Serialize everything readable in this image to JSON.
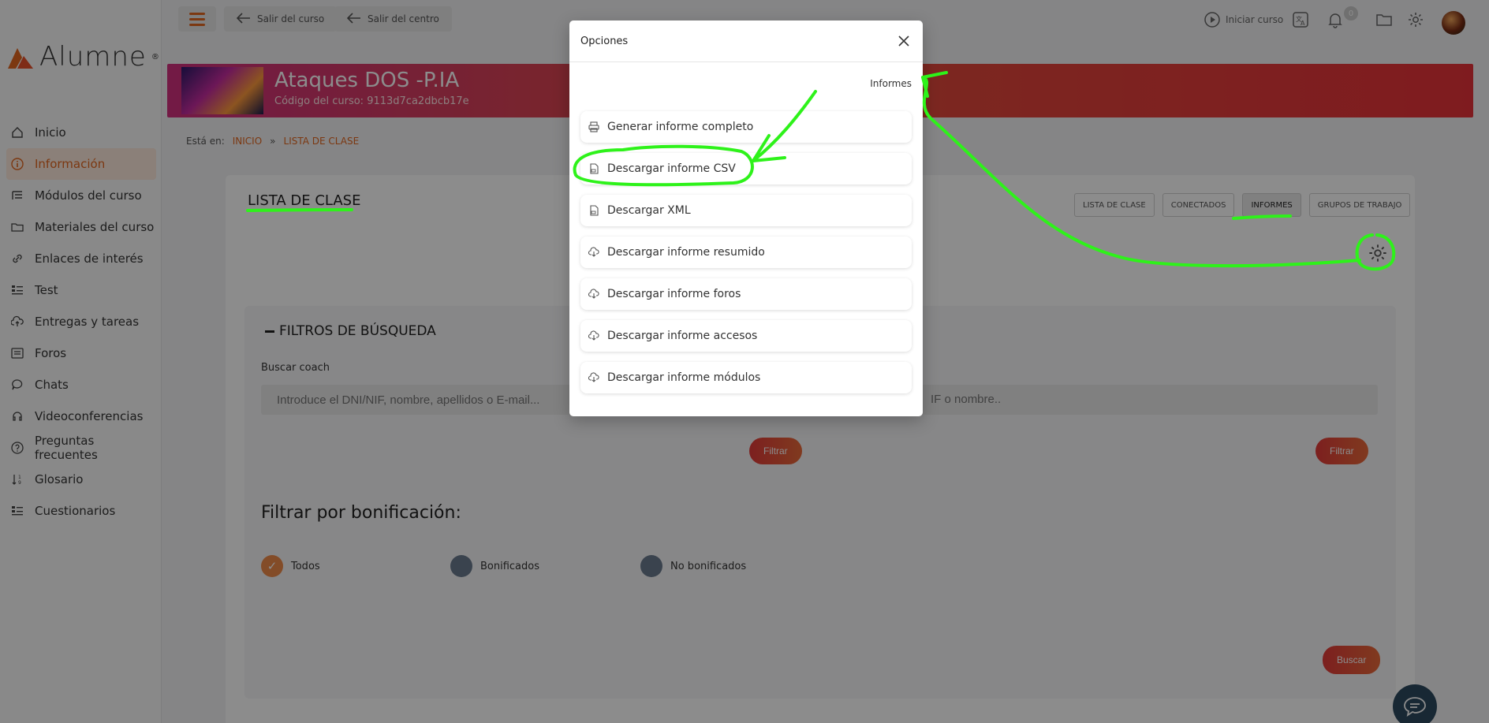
{
  "topbar": {
    "exit_course": "Salir del curso",
    "exit_center": "Salir del centro",
    "start_course": "Iniciar curso",
    "notif_count": "0"
  },
  "brand": {
    "name": "Alumne"
  },
  "sidebar": {
    "items": [
      {
        "label": "Inicio",
        "icon": "home-icon"
      },
      {
        "label": "Información",
        "icon": "info-icon"
      },
      {
        "label": "Módulos del curso",
        "icon": "modules-icon"
      },
      {
        "label": "Materiales del curso",
        "icon": "folder-icon"
      },
      {
        "label": "Enlaces de interés",
        "icon": "link-icon"
      },
      {
        "label": "Test",
        "icon": "test-icon"
      },
      {
        "label": "Entregas y tareas",
        "icon": "upload-icon"
      },
      {
        "label": "Foros",
        "icon": "forum-icon"
      },
      {
        "label": "Chats",
        "icon": "chat-icon"
      },
      {
        "label": "Videoconferencias",
        "icon": "headset-icon"
      },
      {
        "label": "Preguntas frecuentes",
        "icon": "question-icon"
      },
      {
        "label": "Glosario",
        "icon": "sort-icon"
      },
      {
        "label": "Cuestionarios",
        "icon": "quiz-icon"
      }
    ]
  },
  "course": {
    "title": "Ataques DOS -P.IA",
    "code": "Código del curso: 9113d7ca2dbcb17e"
  },
  "breadcrumb": {
    "prefix": "Está en:",
    "home": "INICIO",
    "sep": "»",
    "current": "LISTA DE CLASE"
  },
  "main": {
    "title": "LISTA DE CLASE",
    "tabs": [
      "LISTA DE CLASE",
      "CONECTADOS",
      "INFORMES",
      "GRUPOS DE TRABAJO"
    ],
    "filters_title": "FILTROS DE BÚSQUEDA",
    "search_coach_label": "Buscar coach",
    "search_placeholder": "Introduce el DNI/NIF, nombre, apellidos o E-mail...",
    "search_placeholder_2": "IF o nombre..",
    "filter_btn": "Filtrar",
    "bonus_title": "Filtrar por bonificación:",
    "bonus_options": [
      "Todos",
      "Bonificados",
      "No bonificados"
    ],
    "search_btn": "Buscar"
  },
  "modal": {
    "title": "Opciones",
    "section": "Informes",
    "items": [
      {
        "label": "Generar informe completo",
        "icon": "printer-icon"
      },
      {
        "label": "Descargar informe CSV",
        "icon": "csv-file-icon"
      },
      {
        "label": "Descargar XML",
        "icon": "xml-file-icon"
      },
      {
        "label": "Descargar informe resumido",
        "icon": "cloud-download-icon"
      },
      {
        "label": "Descargar informe foros",
        "icon": "cloud-download-icon"
      },
      {
        "label": "Descargar informe accesos",
        "icon": "cloud-download-icon"
      },
      {
        "label": "Descargar informe módulos",
        "icon": "cloud-download-icon"
      }
    ]
  },
  "colors": {
    "accent": "#e2661f",
    "annotation": "#2ef21a",
    "banner": "#e04e3c"
  }
}
